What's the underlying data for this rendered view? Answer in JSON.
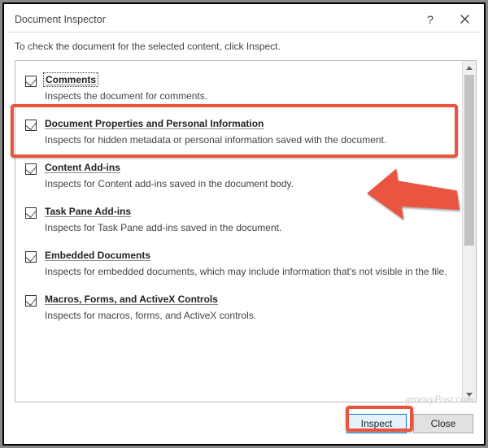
{
  "titlebar": {
    "title": "Document Inspector",
    "help": "?",
    "close": "×"
  },
  "instruction": "To check the document for the selected content, click Inspect.",
  "items": [
    {
      "title": "Comments",
      "desc": "Inspects the document for comments."
    },
    {
      "title": "Document Properties and Personal Information",
      "desc": "Inspects for hidden metadata or personal information saved with the document."
    },
    {
      "title": "Content Add-ins",
      "desc": "Inspects for Content add-ins saved in the document body."
    },
    {
      "title": "Task Pane Add-ins",
      "desc": "Inspects for Task Pane add-ins saved in the document."
    },
    {
      "title": "Embedded Documents",
      "desc": "Inspects for embedded documents, which may include information that's not visible in the file."
    },
    {
      "title": "Macros, Forms, and ActiveX Controls",
      "desc": "Inspects for macros, forms, and ActiveX controls."
    }
  ],
  "footer": {
    "inspect": "Inspect",
    "close": "Close"
  },
  "watermark": "groovyPost.com"
}
